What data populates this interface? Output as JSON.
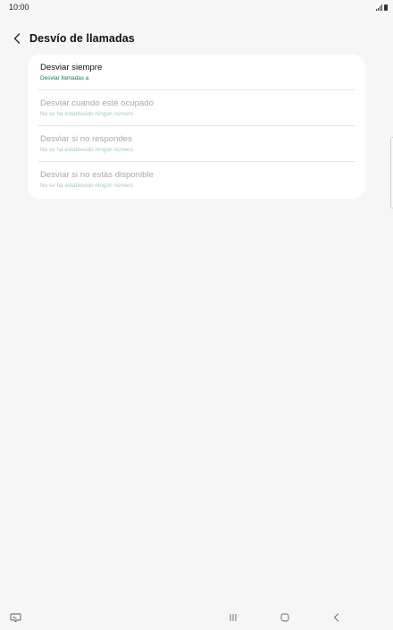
{
  "status_bar": {
    "time": "10:00"
  },
  "header": {
    "title": "Desvío de llamadas"
  },
  "forwarding_options": [
    {
      "title": "Desviar siempre",
      "subtitle": "Desviar llamadas a",
      "enabled": true
    },
    {
      "title": "Desviar cuando esté ocupado",
      "subtitle": "No se ha establecido ningún número",
      "enabled": false
    },
    {
      "title": "Desviar si no respondes",
      "subtitle": "No se ha establecido ningún número",
      "enabled": false
    },
    {
      "title": "Desviar si no estás disponible",
      "subtitle": "No se ha establecido ningún número",
      "enabled": false
    }
  ],
  "colors": {
    "background": "#f6f6f6",
    "card": "#ffffff",
    "accent_subtitle": "#0f7a55",
    "disabled_subtitle": "#a4c8bb",
    "disabled_title": "#a9a9a9"
  },
  "icons": {
    "back": "chevron-left-icon",
    "signal": "signal-icon",
    "battery": "battery-icon",
    "keyboard": "keyboard-icon",
    "recents": "recents-icon",
    "home": "home-icon",
    "nav_back": "nav-back-icon"
  }
}
